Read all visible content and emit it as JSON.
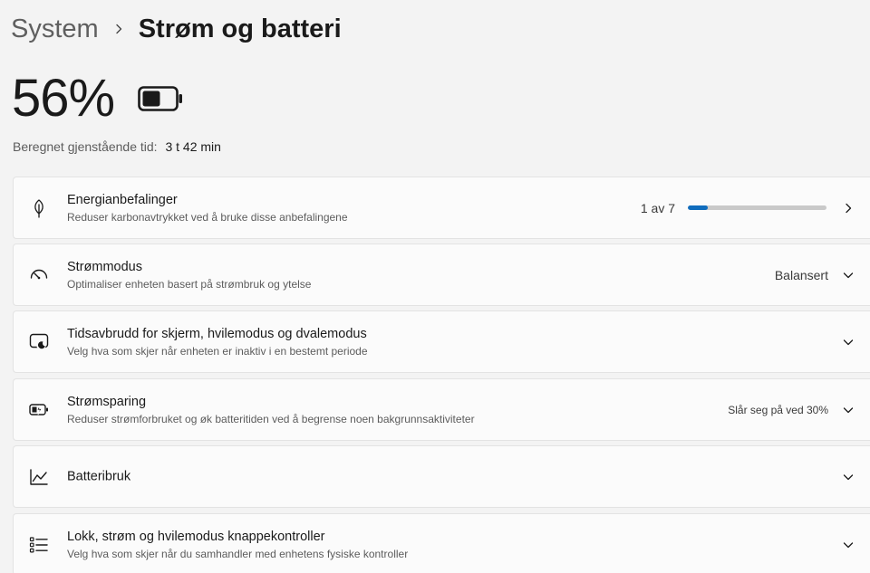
{
  "breadcrumb": {
    "parent": "System",
    "current": "Strøm og batteri"
  },
  "battery": {
    "percent_text": "56%",
    "level": 0.56,
    "remaining_label": "Beregnet gjenstående tid:",
    "remaining_value": "3 t 42 min"
  },
  "cards": [
    {
      "icon": "leaf-icon",
      "title": "Energianbefalinger",
      "subtitle": "Reduser karbonavtrykket ved å bruke disse anbefalingene",
      "status": "1 av 7",
      "progress": 0.143,
      "control": "chevron-right-icon"
    },
    {
      "icon": "gauge-icon",
      "title": "Strømmodus",
      "subtitle": "Optimaliser enheten basert på strømbruk og ytelse",
      "status": "Balansert",
      "control": "chevron-down-icon"
    },
    {
      "icon": "screen-sleep-icon",
      "title": "Tidsavbrudd for skjerm, hvilemodus og dvalemodus",
      "subtitle": "Velg hva som skjer når enheten er inaktiv i en bestemt periode",
      "control": "chevron-down-icon"
    },
    {
      "icon": "battery-saver-icon",
      "title": "Strømsparing",
      "subtitle": "Reduser strømforbruket og øk batteritiden ved å begrense noen bakgrunnsaktiviteter",
      "status": "Slår seg på ved 30%",
      "control": "chevron-down-icon"
    },
    {
      "icon": "chart-line-icon",
      "title": "Batteribruk",
      "control": "chevron-down-icon"
    },
    {
      "icon": "list-icon",
      "title": "Lokk, strøm og hvilemodus knappekontroller",
      "subtitle": "Velg hva som skjer når du samhandler med enhetens fysiske kontroller",
      "control": "chevron-down-icon"
    }
  ],
  "colors": {
    "accent": "#0f6cbd",
    "background": "#f3f3f3",
    "card": "#fbfbfb"
  }
}
